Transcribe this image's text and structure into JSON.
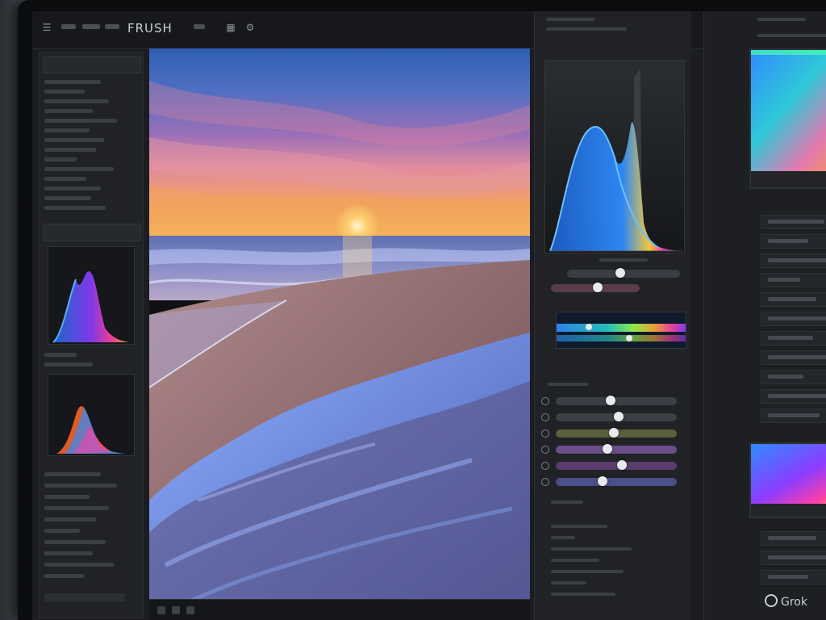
{
  "app": {
    "title": "FRUSH"
  },
  "panels": {
    "left": {
      "header_1": "",
      "header_2": ""
    },
    "right": {
      "top_label": ""
    }
  },
  "watermark": {
    "text": "Grok"
  },
  "sliders": [
    {
      "name": "slider-1",
      "value": 0.45,
      "track": "#3c4046"
    },
    {
      "name": "slider-2",
      "value": 0.52,
      "track": "#3c4046"
    },
    {
      "name": "slider-3",
      "value": 0.48,
      "track": "#5a5f3c"
    },
    {
      "name": "slider-4",
      "value": 0.42,
      "track": "#6b4d8a"
    },
    {
      "name": "slider-5",
      "value": 0.55,
      "track": "#5a3d6e"
    },
    {
      "name": "slider-6",
      "value": 0.38,
      "track": "#4a4f8a"
    }
  ],
  "colors": {
    "accent": "#2f8cff",
    "histogram_blue": "#2b6fd1",
    "histogram_pink": "#ff3fa8"
  }
}
